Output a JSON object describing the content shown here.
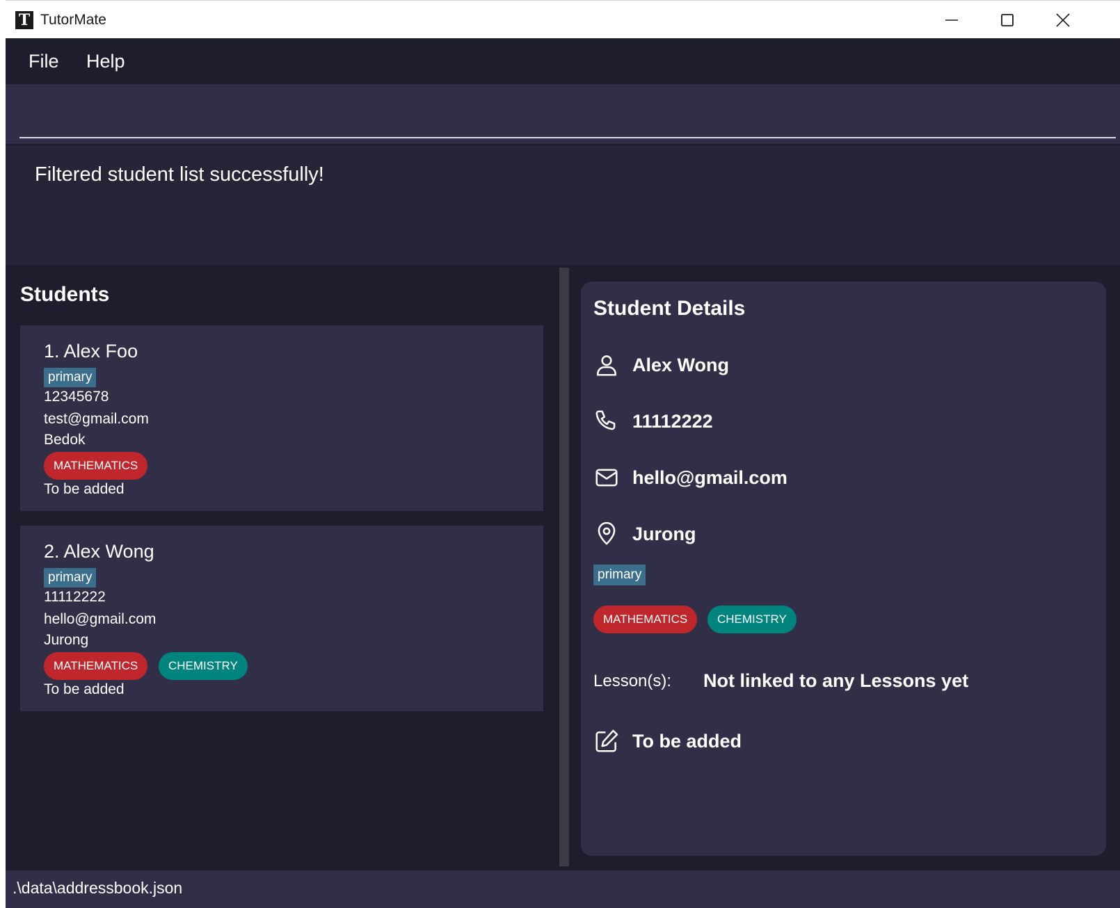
{
  "window": {
    "title": "TutorMate",
    "logo_letter": "T"
  },
  "menu": {
    "file": "File",
    "help": "Help"
  },
  "command": {
    "value": "",
    "placeholder": ""
  },
  "result": {
    "message": "Filtered student list successfully!"
  },
  "student_list": {
    "title": "Students",
    "students": [
      {
        "index_name": "1.  Alex Foo",
        "level": "primary",
        "phone": "12345678",
        "email": "test@gmail.com",
        "address": "Bedok",
        "subjects": [
          "MATHEMATICS"
        ],
        "note": "To be added"
      },
      {
        "index_name": "2.  Alex Wong",
        "level": "primary",
        "phone": "11112222",
        "email": "hello@gmail.com",
        "address": "Jurong",
        "subjects": [
          "MATHEMATICS",
          "CHEMISTRY"
        ],
        "note": "To be added"
      }
    ]
  },
  "details": {
    "title": "Student Details",
    "name": "Alex Wong",
    "phone": "11112222",
    "email": "hello@gmail.com",
    "address": "Jurong",
    "level": "primary",
    "subjects": [
      "MATHEMATICS",
      "CHEMISTRY"
    ],
    "lessons_label": "Lesson(s):",
    "lessons_value": "Not linked to any Lessons yet",
    "note": "To be added"
  },
  "status": {
    "path": ".\\data\\addressbook.json"
  },
  "colors": {
    "mathematics": "#c0272d",
    "chemistry": "#00857e",
    "level_tag": "#3a6e8c"
  }
}
